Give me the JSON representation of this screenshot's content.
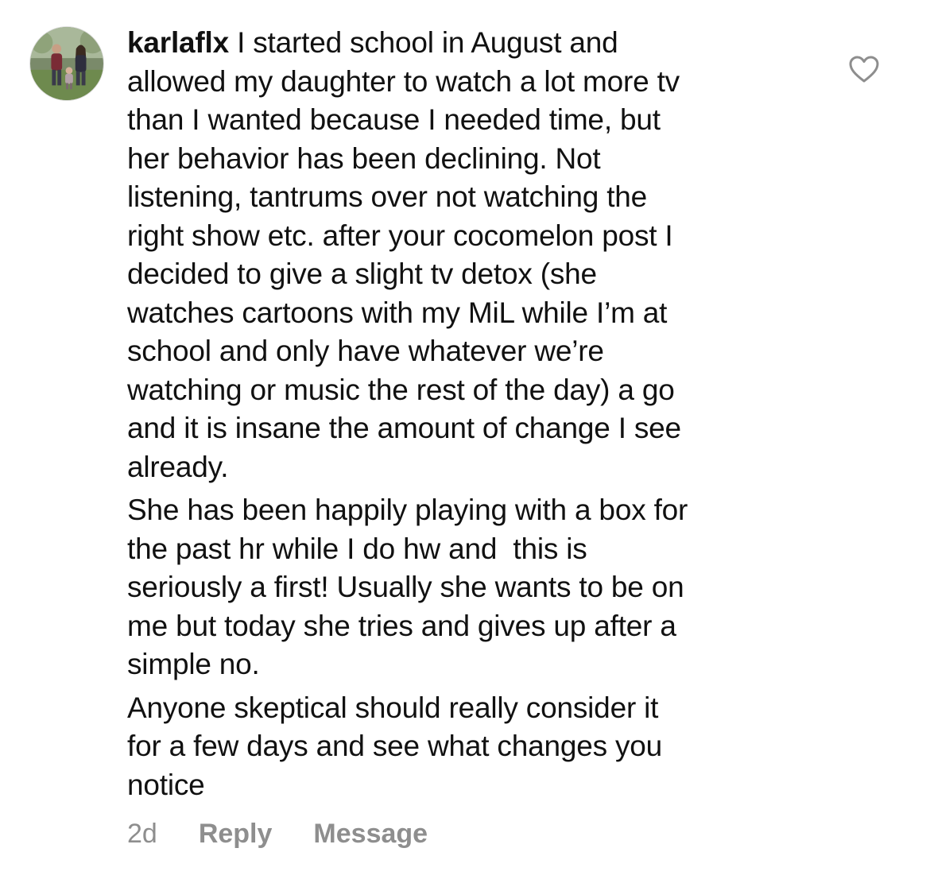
{
  "comment": {
    "username": "karlaflx",
    "paragraphs": [
      "I started school in August and allowed my daughter to watch a lot more tv than I wanted because I needed time, but her behavior has been declining. Not listening, tantrums over not watching the right show etc. after your cocomelon post I decided to give a slight tv detox (she watches cartoons with my MiL while I’m at school and only have whatever we’re watching or music the rest of the day) a go and it is insane the amount of change I see already.",
      "She has been happily playing with a box for the past hr while I do hw and  this is seriously a first! Usually she wants to be on me but today she tries and gives up after a simple no.",
      "Anyone skeptical should really consider it for a few days and see what changes you notice"
    ],
    "lines": [
      [
        "I started school in August and",
        "allowed my daughter to watch a lot more tv",
        "than I wanted because I needed time, but",
        "her behavior has been declining. Not",
        "listening, tantrums over not watching the",
        "right show etc. after your cocomelon post I",
        "decided to give a slight tv detox (she",
        "watches cartoons with my MiL while I’m at",
        "school and only have whatever we’re",
        "watching or music the rest of the day) a go",
        "and it is insane the amount of change I see",
        "already."
      ],
      [
        "She has been happily playing with a box for",
        "the past hr while I do hw and  this is",
        "seriously a first! Usually she wants to be on",
        "me but today she tries and gives up after a",
        "simple no."
      ],
      [
        "Anyone skeptical should really consider it",
        "for a few days and see what changes you",
        "notice"
      ]
    ],
    "timestamp": "2d",
    "reply_label": "Reply",
    "message_label": "Message"
  },
  "icons": {
    "like": "heart-outline-icon",
    "avatar": "profile-photo"
  },
  "colors": {
    "text": "#111111",
    "meta_text": "#8e8e8e",
    "icon_stroke": "#8e8e8e",
    "background": "#ffffff"
  }
}
